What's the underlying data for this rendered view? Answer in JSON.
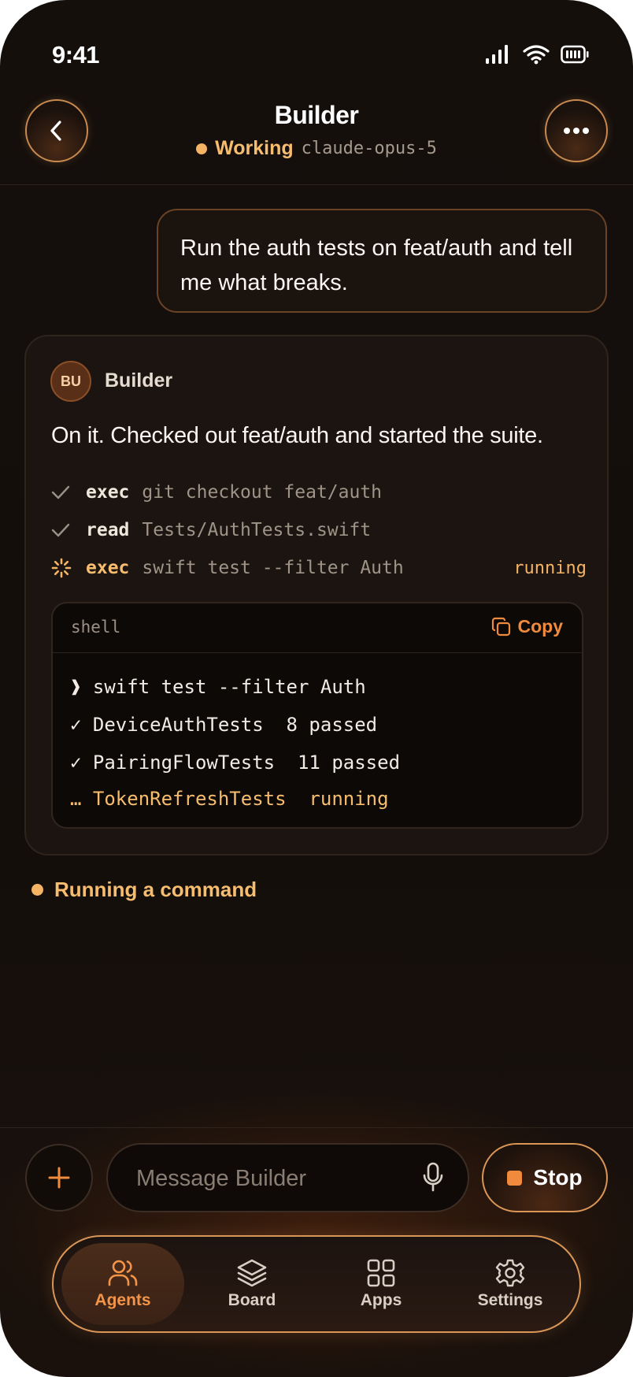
{
  "status_bar": {
    "time": "9:41"
  },
  "header": {
    "title": "Builder",
    "status_label": "Working",
    "model": "claude-opus-5"
  },
  "user_message": {
    "text": "Run the auth tests on feat/auth and tell me what breaks."
  },
  "agent_message": {
    "avatar_initials": "BU",
    "agent_name": "Builder",
    "text": "On it. Checked out feat/auth and started the suite.",
    "steps": [
      {
        "verb": "exec",
        "arg": "git checkout feat/auth",
        "state": ""
      },
      {
        "verb": "read",
        "arg": "Tests/AuthTests.swift",
        "state": ""
      },
      {
        "verb": "exec",
        "arg": "swift test --filter Auth",
        "state": "running"
      }
    ],
    "shell": {
      "label": "shell",
      "copy_label": "Copy",
      "lines": [
        "❱ swift test --filter Auth",
        "✓ DeviceAuthTests  8 passed",
        "✓ PairingFlowTests  11 passed",
        "… TokenRefreshTests  running"
      ]
    }
  },
  "activity": {
    "text": "Running a command"
  },
  "composer": {
    "placeholder": "Message Builder",
    "stop_label": "Stop"
  },
  "tabbar": {
    "tabs": [
      {
        "label": "Agents",
        "icon": "people-icon",
        "active": true
      },
      {
        "label": "Board",
        "icon": "layers-icon",
        "active": false
      },
      {
        "label": "Apps",
        "icon": "grid-icon",
        "active": false
      },
      {
        "label": "Settings",
        "icon": "gear-icon",
        "active": false
      }
    ]
  },
  "colors": {
    "accent": "#f08a3c",
    "status": "#f5b463",
    "background": "#150f0c"
  }
}
